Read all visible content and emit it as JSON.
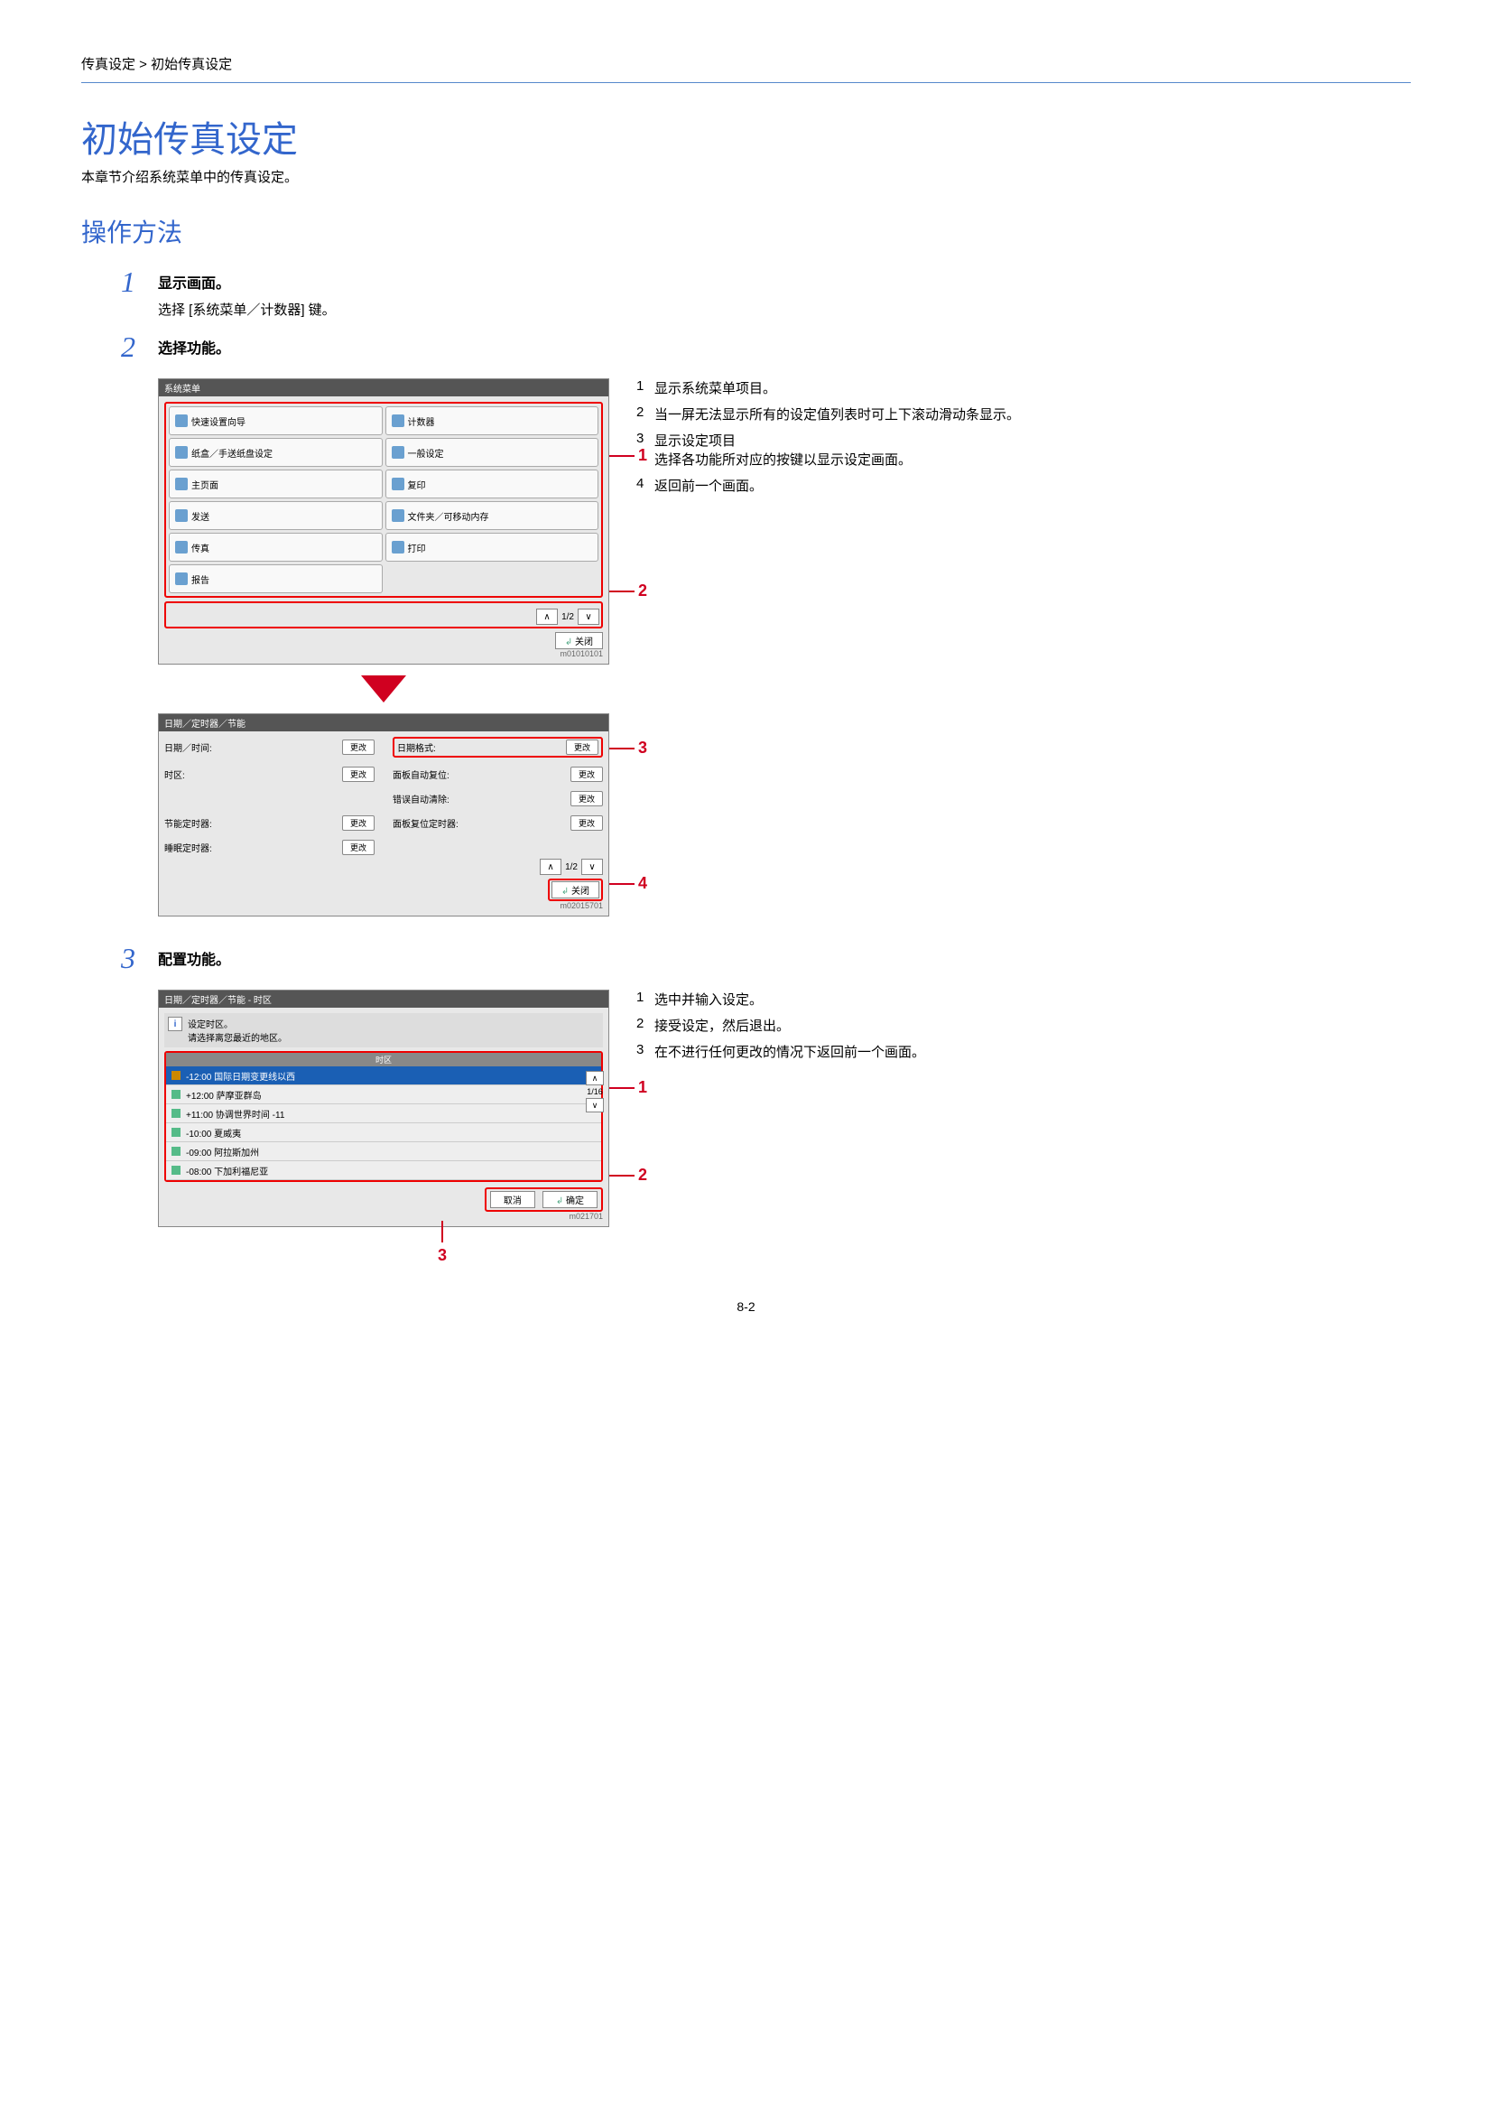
{
  "breadcrumb": "传真设定 > 初始传真设定",
  "title": "初始传真设定",
  "intro": "本章节介绍系统菜单中的传真设定。",
  "section": "操作方法",
  "page_number": "8-2",
  "steps": {
    "s1": {
      "num": "1",
      "title": "显示画面。",
      "body": "选择 [系统菜单／计数器] 键。"
    },
    "s2": {
      "num": "2",
      "title": "选择功能。",
      "notes": [
        "显示系统菜单项目。",
        "当一屏无法显示所有的设定值列表时可上下滚动滑动条显示。",
        "显示设定项目\n选择各功能所对应的按键以显示设定画面。",
        "返回前一个画面。"
      ]
    },
    "s3": {
      "num": "3",
      "title": "配置功能。",
      "notes": [
        "选中并输入设定。",
        "接受设定，然后退出。",
        "在不进行任何更改的情况下返回前一个画面。"
      ]
    }
  },
  "panel1": {
    "title": "系统菜单",
    "items_left": [
      "快速设置向导",
      "纸盒／手送纸盘设定",
      "主页面",
      "发送",
      "传真",
      "报告"
    ],
    "items_right": [
      "计数器",
      "一般设定",
      "复印",
      "文件夹／可移动内存",
      "打印"
    ],
    "pager": "1/2",
    "close": "关闭",
    "id": "m01010101"
  },
  "panel2": {
    "title": "日期／定时器／节能",
    "left_labels": [
      "日期／时间:",
      "时区:",
      "",
      "节能定时器:",
      "睡眠定时器:"
    ],
    "right_labels": [
      "日期格式:",
      "面板自动复位:",
      "错误自动清除:",
      "面板复位定时器:",
      ""
    ],
    "change_btn": "更改",
    "pager": "1/2",
    "close": "关闭",
    "id": "m02015701"
  },
  "panel3": {
    "title": "日期／定时器／节能 - 时区",
    "hint_line1": "设定时区。",
    "hint_line2": "请选择离您最近的地区。",
    "colhead": "时区",
    "rows": [
      "-12:00 国际日期变更线以西",
      "+12:00 萨摩亚群岛",
      "+11:00 协调世界时间 -11",
      "-10:00 夏威夷",
      "-09:00 阿拉斯加州",
      "-08:00 下加利福尼亚"
    ],
    "scroll_pager": "1/16",
    "cancel": "取消",
    "ok": "确定",
    "id": "m021701"
  }
}
